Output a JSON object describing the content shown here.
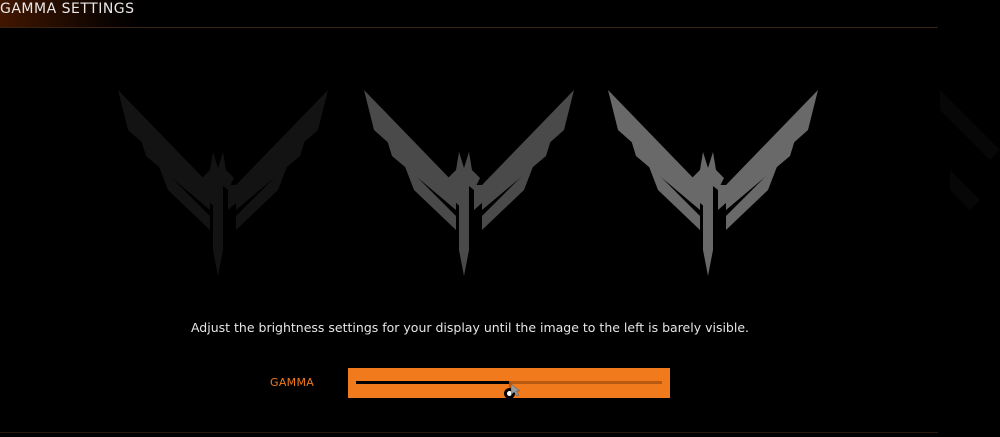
{
  "header": {
    "title": "GAMMA SETTINGS"
  },
  "calibration": {
    "instruction": "Adjust the brightness settings for your display until the image to the left is barely visible.",
    "emblems": [
      {
        "name": "faint-emblem",
        "color": "#131313"
      },
      {
        "name": "dim-emblem",
        "color": "#4a4a4a"
      },
      {
        "name": "bright-emblem",
        "color": "#696969"
      }
    ]
  },
  "gamma": {
    "label": "GAMMA",
    "value_fraction": 0.5,
    "default_fraction": 0.5,
    "accent_color": "#f07a1c"
  }
}
